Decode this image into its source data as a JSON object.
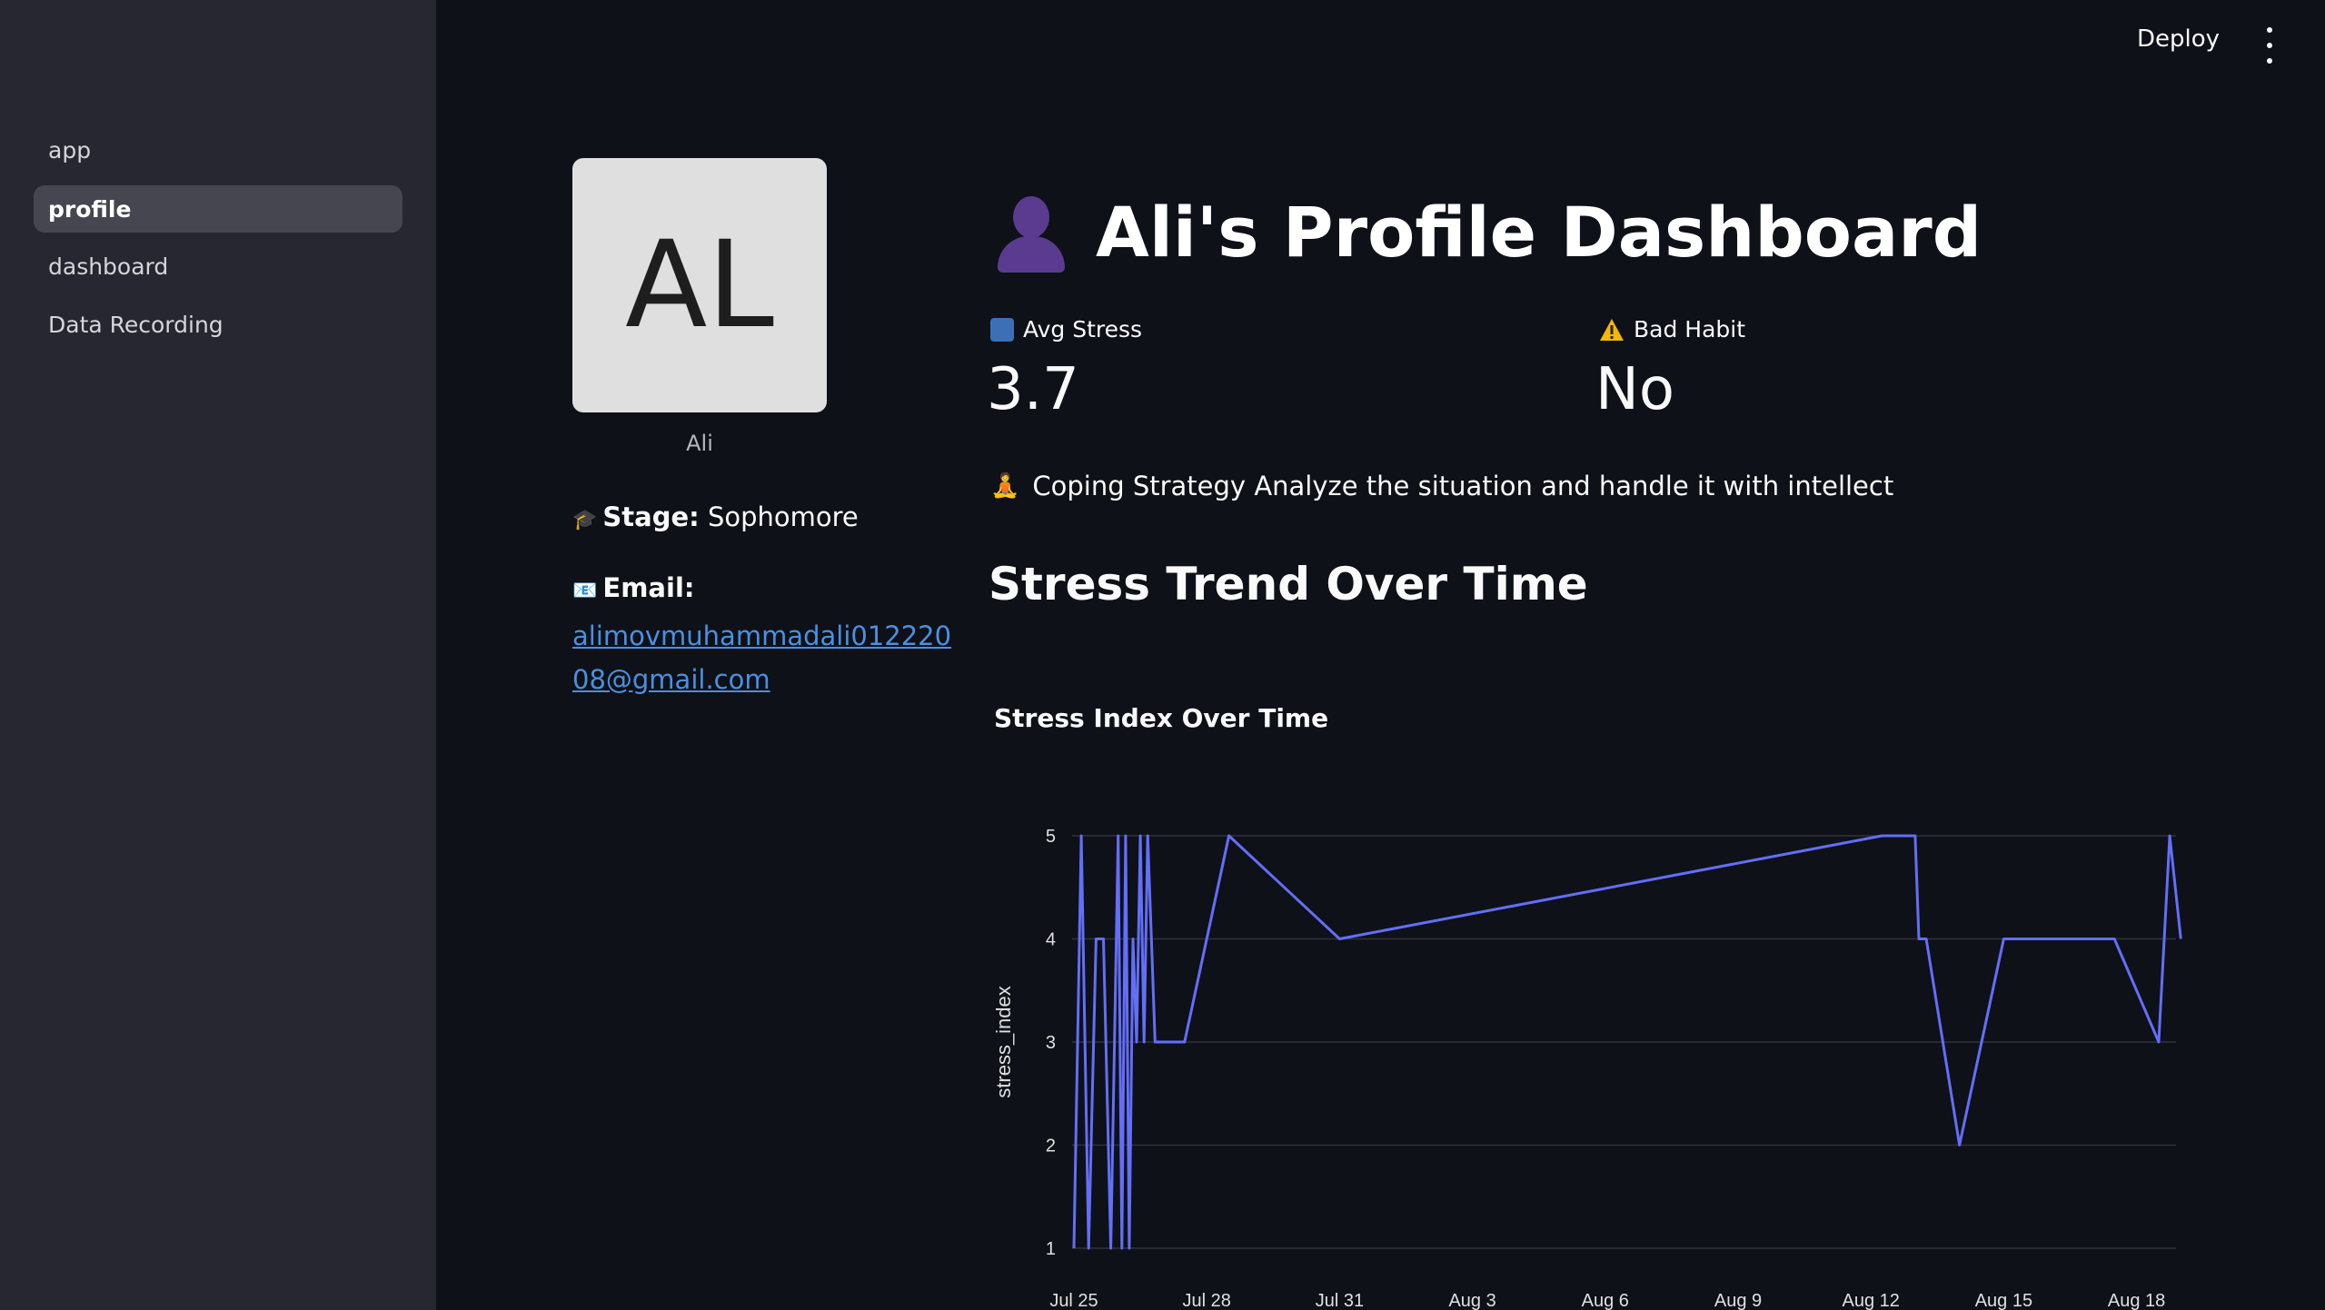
{
  "sidebar": {
    "items": [
      {
        "label": "app",
        "active": false
      },
      {
        "label": "profile",
        "active": true
      },
      {
        "label": "dashboard",
        "active": false
      },
      {
        "label": "Data Recording",
        "active": false
      }
    ]
  },
  "header": {
    "deploy_label": "Deploy",
    "menu_icon": "vertical-ellipsis-icon"
  },
  "profile": {
    "avatar_initials": "AL",
    "name": "Ali",
    "stage_label": "Stage:",
    "stage_value": "Sophomore",
    "stage_icon": "graduation-cap-icon",
    "email_label": "Email:",
    "email_icon": "email-icon",
    "email_value": "alimovmuhammadali01222008@gmail.com"
  },
  "dashboard": {
    "title": "Ali's Profile Dashboard",
    "title_icon": "person-silhouette-icon",
    "metrics": [
      {
        "label": "Avg Stress",
        "value": "3.7",
        "icon": "bar-chart-icon"
      },
      {
        "label": "Bad Habit",
        "value": "No",
        "icon": "warning-icon"
      }
    ],
    "coping_label": "Coping Strategy",
    "coping_value": "Analyze the situation and handle it with intellect",
    "coping_icon": "meditation-icon",
    "section_heading": "Stress Trend Over Time"
  },
  "colors": {
    "background": "#0e1117",
    "sidebar": "#262730",
    "active_nav": "#45464f",
    "link": "#4a90e2",
    "series": "#636efa"
  },
  "chart_data": {
    "type": "line",
    "title": "Stress Index Over Time",
    "xlabel": "",
    "ylabel": "stress_index",
    "ylim": [
      1,
      5
    ],
    "yticks": [
      1,
      2,
      3,
      4,
      5
    ],
    "xticks": [
      "Jul 25",
      "Jul 28",
      "Jul 31",
      "Aug 3",
      "Aug 6",
      "Aug 9",
      "Aug 12",
      "Aug 15",
      "Aug 18"
    ],
    "grid": true,
    "series": [
      {
        "name": "",
        "x": [
          "2025-07-25 00:00",
          "2025-07-25 04:00",
          "2025-07-25 08:00",
          "2025-07-25 12:00",
          "2025-07-25 16:00",
          "2025-07-25 20:00",
          "2025-07-26 00:00",
          "2025-07-26 02:00",
          "2025-07-26 04:00",
          "2025-07-26 06:00",
          "2025-07-26 08:00",
          "2025-07-26 10:00",
          "2025-07-26 12:00",
          "2025-07-26 14:00",
          "2025-07-26 16:00",
          "2025-07-26 18:00",
          "2025-07-26 20:00",
          "2025-07-27 12:00",
          "2025-07-28 12:00",
          "2025-07-31 00:00",
          "2025-08-12 06:00",
          "2025-08-13 00:00",
          "2025-08-13 02:00",
          "2025-08-13 06:00",
          "2025-08-14 00:00",
          "2025-08-15 00:00",
          "2025-08-17 12:00",
          "2025-08-18 12:00",
          "2025-08-18 18:00",
          "2025-08-19 00:00"
        ],
        "y": [
          1,
          5,
          1,
          4,
          4,
          1,
          5,
          1,
          5,
          1,
          4,
          3,
          5,
          3,
          5,
          4,
          3,
          3,
          5,
          4,
          5,
          5,
          4,
          4,
          2,
          4,
          4,
          3,
          5,
          4
        ]
      }
    ]
  }
}
